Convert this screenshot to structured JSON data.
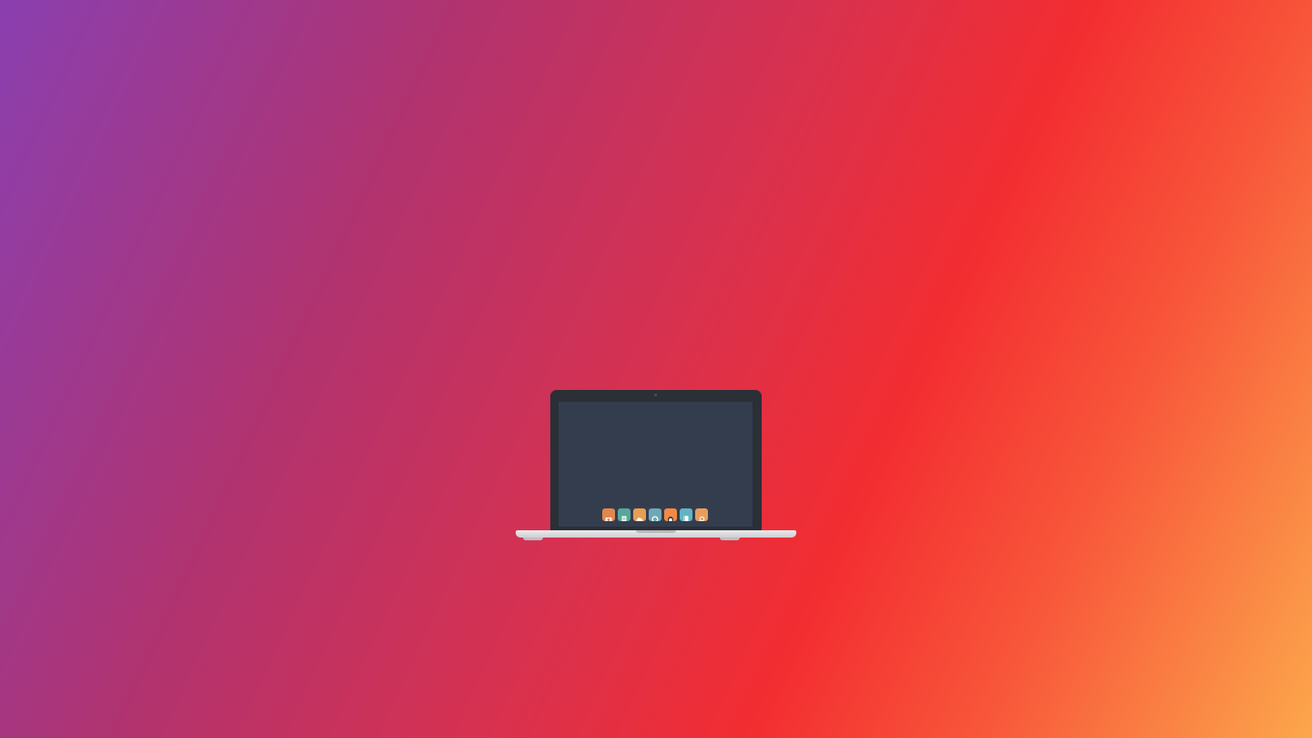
{
  "wallpaper": {
    "colors": [
      "#8a3fb0",
      "#b1336f",
      "#d8314f",
      "#f32d31",
      "#f8573a",
      "#fca74c"
    ]
  },
  "laptop": {
    "bezel_color": "#2b2f36",
    "screen_color": "#343d4e",
    "base_color": "#e9e9ea"
  },
  "dock": {
    "apps": [
      {
        "icon": "camera-icon",
        "color": "#e0874f"
      },
      {
        "icon": "document-icon",
        "color": "#58a89a"
      },
      {
        "icon": "cloud-icon",
        "color": "#e59f52"
      },
      {
        "icon": "compass-icon",
        "color": "#6fa8b6"
      },
      {
        "icon": "contact-icon",
        "color": "#f18a45"
      },
      {
        "icon": "book-icon",
        "color": "#62b4c4"
      },
      {
        "icon": "search-icon",
        "color": "#e79e5c"
      }
    ]
  }
}
